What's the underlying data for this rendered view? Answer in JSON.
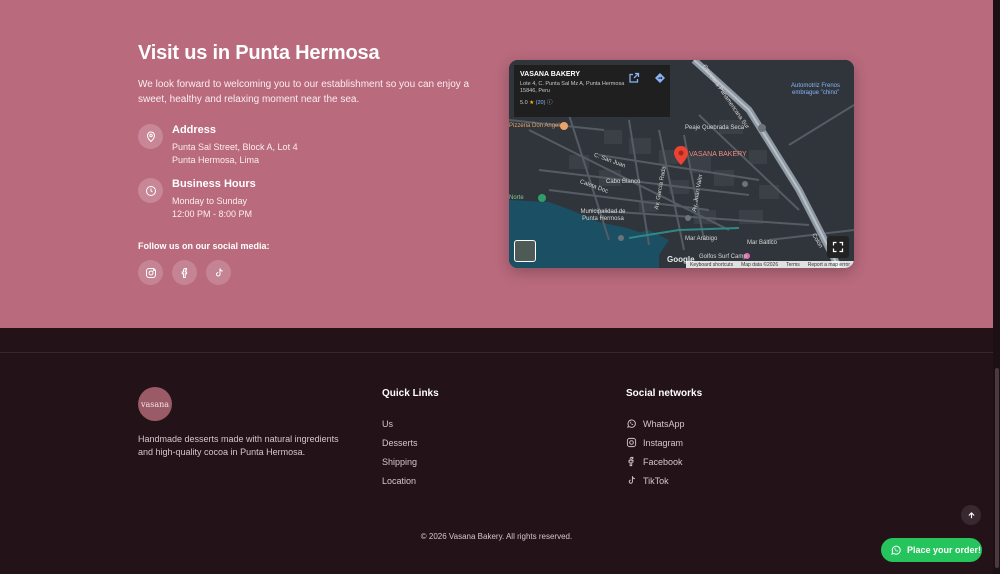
{
  "visit": {
    "title": "Visit us in Punta Hermosa",
    "description": "We look forward to welcoming you to our establishment so you can enjoy a sweet, healthy and relaxing moment near the sea.",
    "address_title": "Address",
    "address_line1": "Punta Sal Street, Block A, Lot 4",
    "address_line2": "Punta Hermosa, Lima",
    "hours_title": "Business Hours",
    "hours_line1": "Monday to Sunday",
    "hours_line2": "12:00 PM - 8:00 PM",
    "follow_text": "Follow us on our social media:",
    "social_icons": [
      "instagram-icon",
      "facebook-icon",
      "tiktok-icon"
    ]
  },
  "map": {
    "place_name": "VASANA BAKERY",
    "place_address": "Lote 4, C. Punta Sal Mz A, Punta Hermosa 15846, Peru",
    "rating": "5.0",
    "reviews": "(20)",
    "pin_label": "VASANA BAKERY",
    "labels": {
      "panamericana": "Carretera Panamericana Sur",
      "automotriz": "Automotriz Frenos",
      "embrague": "embrague \"chino\"",
      "peaje": "Peaje Quebrada Seca",
      "pizzeria": "Pizzeria Don Angelo",
      "san_juan": "C. San Juan",
      "cabo_blanco": "Cabo Blanco",
      "caleta_dos": "Caleta Doc",
      "av_garcia": "Av. García Rada",
      "av_juan_valer": "Av. Juan Valer",
      "municipalidad": "Municipalidad de Punta Hermosa",
      "mar_arabigo": "Mar Arábigo",
      "mar_baltico": "Mar Báltico",
      "golfos": "Golfos Surf Camp",
      "norte": "Norte",
      "colon": "Colón"
    },
    "google": "Google",
    "footer": [
      "Keyboard shortcuts",
      "Map data ©2026",
      "Terms",
      "Report a map error"
    ]
  },
  "footer": {
    "logo_text": "vasana",
    "description": "Handmade desserts made with natural ingredients and high-quality cocoa in Punta Hermosa.",
    "quick_links_title": "Quick Links",
    "quick_links": [
      "Us",
      "Desserts",
      "Shipping",
      "Location"
    ],
    "social_title": "Social networks",
    "social_links": [
      {
        "label": "WhatsApp",
        "icon": "whatsapp-icon"
      },
      {
        "label": "Instagram",
        "icon": "instagram-icon"
      },
      {
        "label": "Facebook",
        "icon": "facebook-icon"
      },
      {
        "label": "TikTok",
        "icon": "tiktok-icon"
      }
    ],
    "copyright": "© 2026 Vasana Bakery. All rights reserved."
  },
  "whatsapp_button": "Place your order!",
  "colors": {
    "visit_bg": "#b96a7d",
    "footer_bg": "#231217",
    "whatsapp_green": "#25c45d"
  }
}
